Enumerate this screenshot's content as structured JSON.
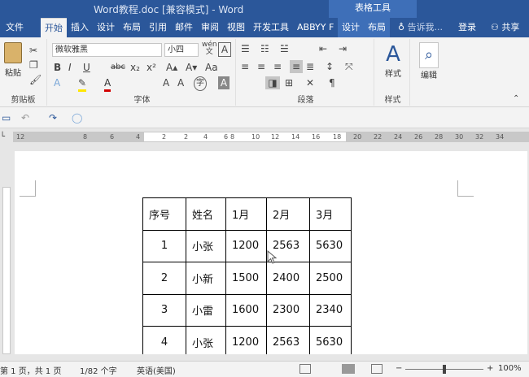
{
  "window": {
    "title": "Word教程.doc [兼容模式] - Word",
    "context_group": "表格工具"
  },
  "tabs": [
    "文件",
    "开始",
    "插入",
    "设计",
    "布局",
    "引用",
    "邮件",
    "审阅",
    "视图",
    "开发工具",
    "ABBYY F",
    "设计",
    "布局"
  ],
  "tell_me": "告诉我...",
  "login": "登录",
  "share": "共享",
  "ribbon": {
    "clipboard": {
      "paste": "粘贴",
      "label": "剪贴板"
    },
    "font": {
      "name": "微软雅黑",
      "size": "小四",
      "label": "字体",
      "wen": "wén",
      "wen_char": "文"
    },
    "paragraph": {
      "label": "段落"
    },
    "styles": {
      "button": "样式",
      "label": "样式"
    },
    "editing": {
      "button": "编辑"
    }
  },
  "ruler_numbers": [
    "12",
    "8",
    "6",
    "4",
    "2",
    "2",
    "4",
    "6",
    "8",
    "10",
    "12",
    "14",
    "16",
    "18",
    "20",
    "22",
    "24",
    "26",
    "28",
    "30",
    "32",
    "34"
  ],
  "table": {
    "rows": [
      [
        "序号",
        "姓名",
        "1月",
        "2月",
        "3月"
      ],
      [
        "1",
        "小张",
        "1200",
        "2563",
        "5630"
      ],
      [
        "2",
        "小新",
        "1500",
        "2400",
        "2500"
      ],
      [
        "3",
        "小雷",
        "1600",
        "2300",
        "2340"
      ],
      [
        "4",
        "小张",
        "1200",
        "2563",
        "5630"
      ]
    ]
  },
  "statusbar": {
    "page": "第 1 页，共 1 页",
    "words": "1/82 个字",
    "lang": "英语(美国)",
    "zoom": "100%"
  },
  "colors": {
    "accent": "#2b579a",
    "context": "#3e6fb8"
  }
}
